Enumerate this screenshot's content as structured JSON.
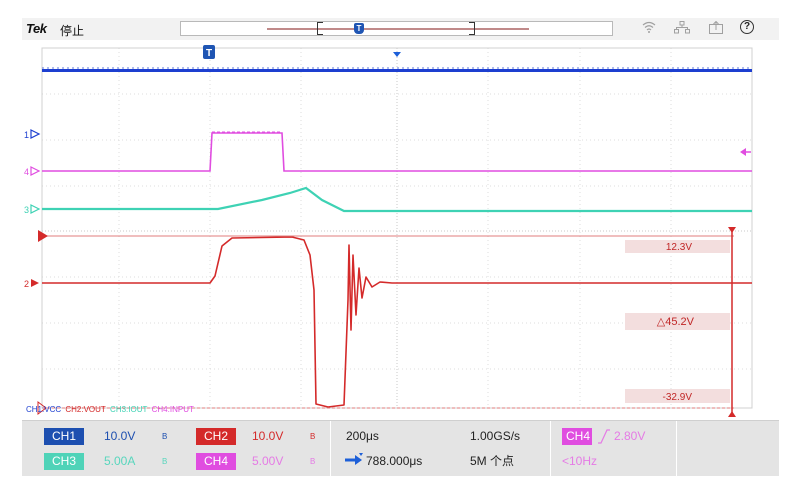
{
  "header": {
    "brand": "Tek",
    "status": "停止",
    "icons": [
      "wifi-icon",
      "network-icon",
      "export-icon",
      "help-icon"
    ],
    "help_label": "?"
  },
  "trigger_marker": "T",
  "channel_markers": {
    "ch1": "1",
    "ch2": "2",
    "ch3": "3",
    "ch4": "4"
  },
  "cursors": {
    "upper": "12.3V",
    "delta": "△45.2V",
    "lower": "-32.9V"
  },
  "legend": {
    "ch1": "CH1:VCC",
    "ch2": "CH2:VOUT",
    "ch3": "CH3:IOUT",
    "ch4": "CH4:INPUT"
  },
  "footer": {
    "ch1": {
      "label": "CH1",
      "scale": "10.0V",
      "bw": "B",
      "color": "#1d4fb0"
    },
    "ch2": {
      "label": "CH2",
      "scale": "10.0V",
      "bw": "B",
      "color": "#d42a2a"
    },
    "ch3": {
      "label": "CH3",
      "scale": "5.00A",
      "bw": "B",
      "color": "#4fd3b8"
    },
    "ch4": {
      "label": "CH4",
      "scale": "5.00V",
      "bw": "B",
      "color": "#e04de0"
    },
    "timebase": "200μs",
    "position": "788.000μs",
    "sample_rate": "1.00GS/s",
    "record_length": "5M 个点",
    "trigger_source": "CH4",
    "trigger_level": "2.80V",
    "trigger_freq": "<10Hz"
  },
  "colors": {
    "ch1": "#1d3fd0",
    "ch2": "#d42a2a",
    "ch3": "#3ed2b4",
    "ch4": "#e04de0",
    "grid": "#d8d8d8"
  }
}
